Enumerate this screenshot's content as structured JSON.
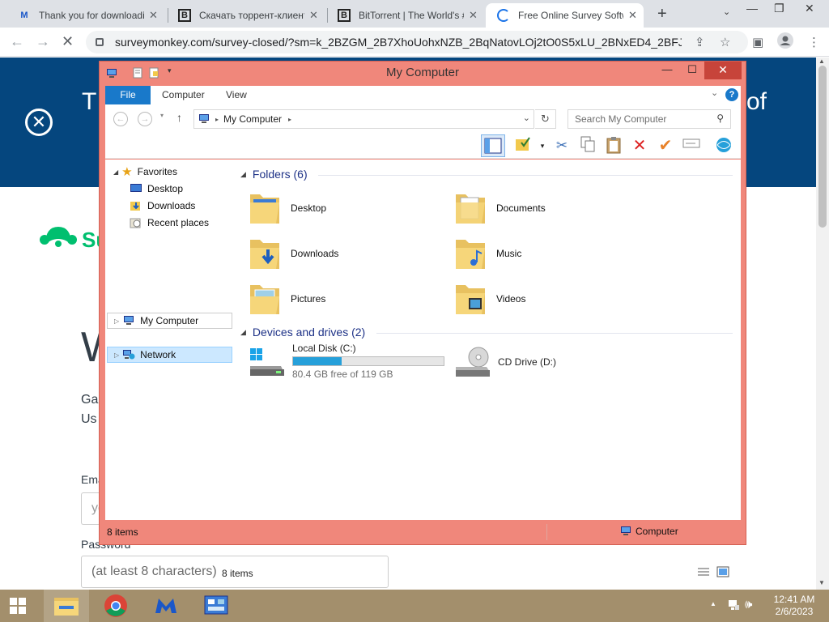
{
  "browser": {
    "tabs": [
      {
        "title": "Thank you for downloading",
        "favicon": "malwarebytes-icon"
      },
      {
        "title": "Скачать торрент-клиент",
        "favicon": "b-icon"
      },
      {
        "title": "BitTorrent | The World's #",
        "favicon": "b-icon"
      },
      {
        "title": "Free Online Survey Software",
        "favicon": "loading-icon"
      }
    ],
    "url": "surveymonkey.com/survey-closed/?sm=k_2BZGM_2B7XhoUohxNZB_2BqNatovLOj2tO0S5xLU_2BNxED4_2BFJoeT..."
  },
  "page": {
    "banner_left": "T",
    "banner_right": "of",
    "logo_text": "Su",
    "heading": "W",
    "sub1": "Ga",
    "sub2": "Us",
    "email_label": "Ema",
    "email_placeholder": "yo",
    "password_label": "Password",
    "password_placeholder": "(at least 8 characters)"
  },
  "explorer": {
    "title": "My Computer",
    "ribbon_tabs": [
      "File",
      "Computer",
      "View"
    ],
    "address_path": "My Computer",
    "search_placeholder": "Search My Computer",
    "nav": {
      "favorites": "Favorites",
      "desktop": "Desktop",
      "downloads": "Downloads",
      "recent": "Recent places",
      "my_computer": "My Computer",
      "network": "Network"
    },
    "folders_header": "Folders (6)",
    "folders": [
      "Desktop",
      "Documents",
      "Downloads",
      "Music",
      "Pictures",
      "Videos"
    ],
    "drives_header": "Devices and drives (2)",
    "drives": [
      {
        "name": "Local Disk (C:)",
        "free": "80.4 GB free of 119 GB",
        "used_fraction": 0.324
      },
      {
        "name": "CD Drive (D:)"
      }
    ],
    "items_inner": "8 items",
    "items_status": "8 items",
    "status_location": "Computer"
  },
  "taskbar": {
    "time": "12:41 AM",
    "date": "2/6/2023"
  },
  "colors": {
    "window_frame": "#f0877b",
    "banner": "#05467e",
    "brand_green": "#00bf6f",
    "ribbon_file": "#1979ca"
  }
}
